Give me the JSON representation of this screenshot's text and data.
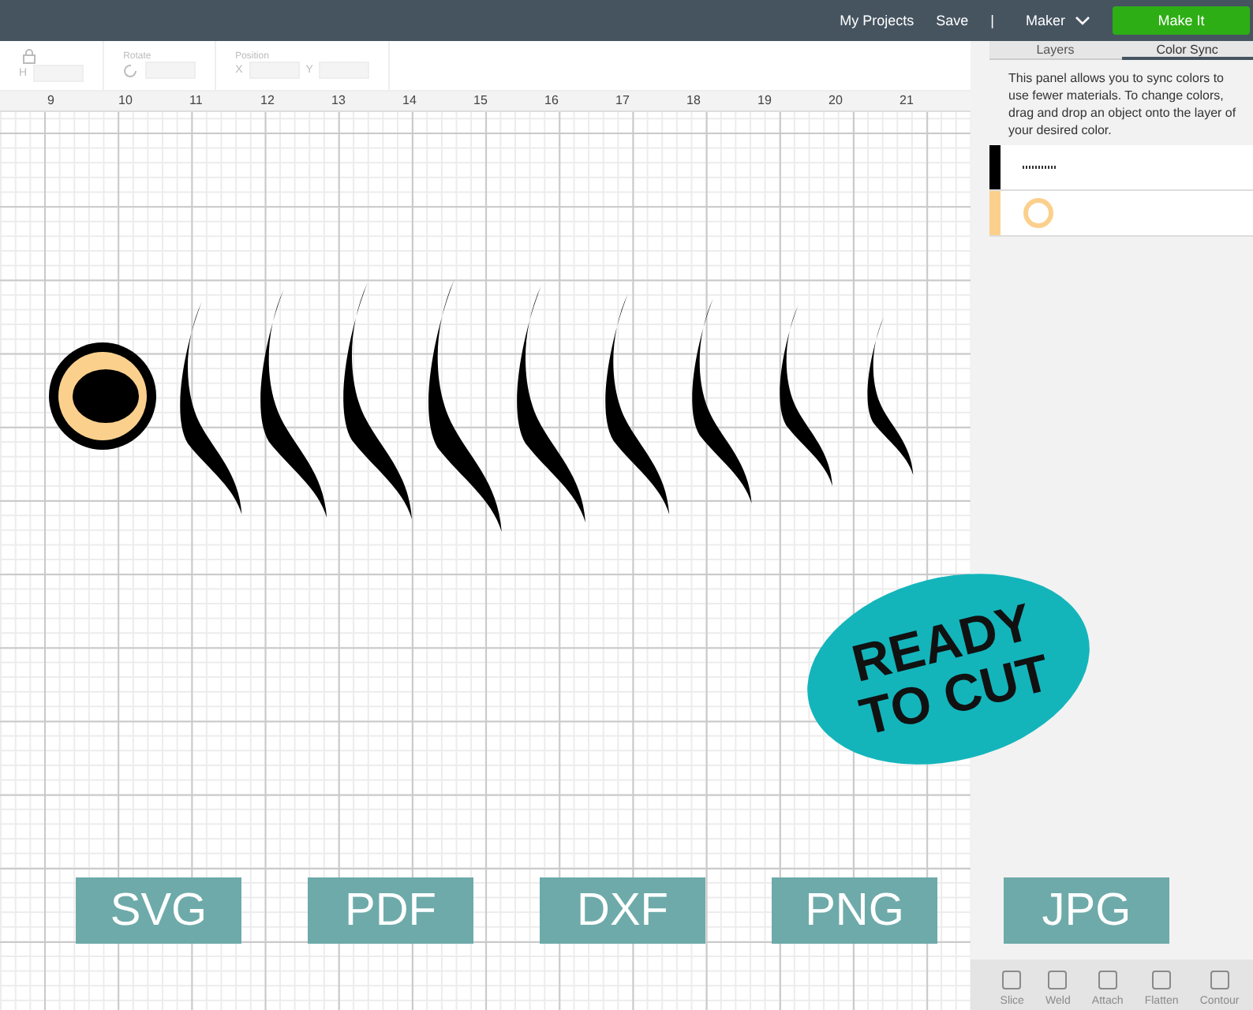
{
  "top_bar": {
    "links": [
      "My Projects",
      "Save"
    ],
    "separator": "|",
    "machine": "Maker",
    "make_button": "Make It"
  },
  "toolbar": {
    "size_label": "H",
    "rotate_label": "Rotate",
    "position_label": "Position",
    "x_label": "X",
    "y_label": "Y"
  },
  "ruler": [
    "9",
    "10",
    "11",
    "12",
    "13",
    "14",
    "15",
    "16",
    "17",
    "18",
    "19",
    "20",
    "21"
  ],
  "panel": {
    "tabs": [
      {
        "label": "Layers",
        "selected": false
      },
      {
        "label": "Color Sync",
        "selected": true
      }
    ],
    "description": "This panel allows you to sync colors to use fewer materials. To change colors, drag and drop an object onto the layer of your desired color.",
    "layers": [
      {
        "kind": "strokes",
        "color": "#000000"
      },
      {
        "kind": "ring",
        "color": "#fbd08d"
      }
    ],
    "tools": [
      {
        "label": "Slice",
        "disabled": true
      },
      {
        "label": "Weld",
        "disabled": true
      },
      {
        "label": "Attach",
        "disabled": true
      },
      {
        "label": "Flatten",
        "disabled": true
      },
      {
        "label": "Contour",
        "disabled": true
      }
    ]
  },
  "badge": {
    "lines": [
      "READY",
      "TO CUT"
    ]
  },
  "formats": [
    "SVG",
    "PDF",
    "DXF",
    "PNG",
    "JPG"
  ]
}
